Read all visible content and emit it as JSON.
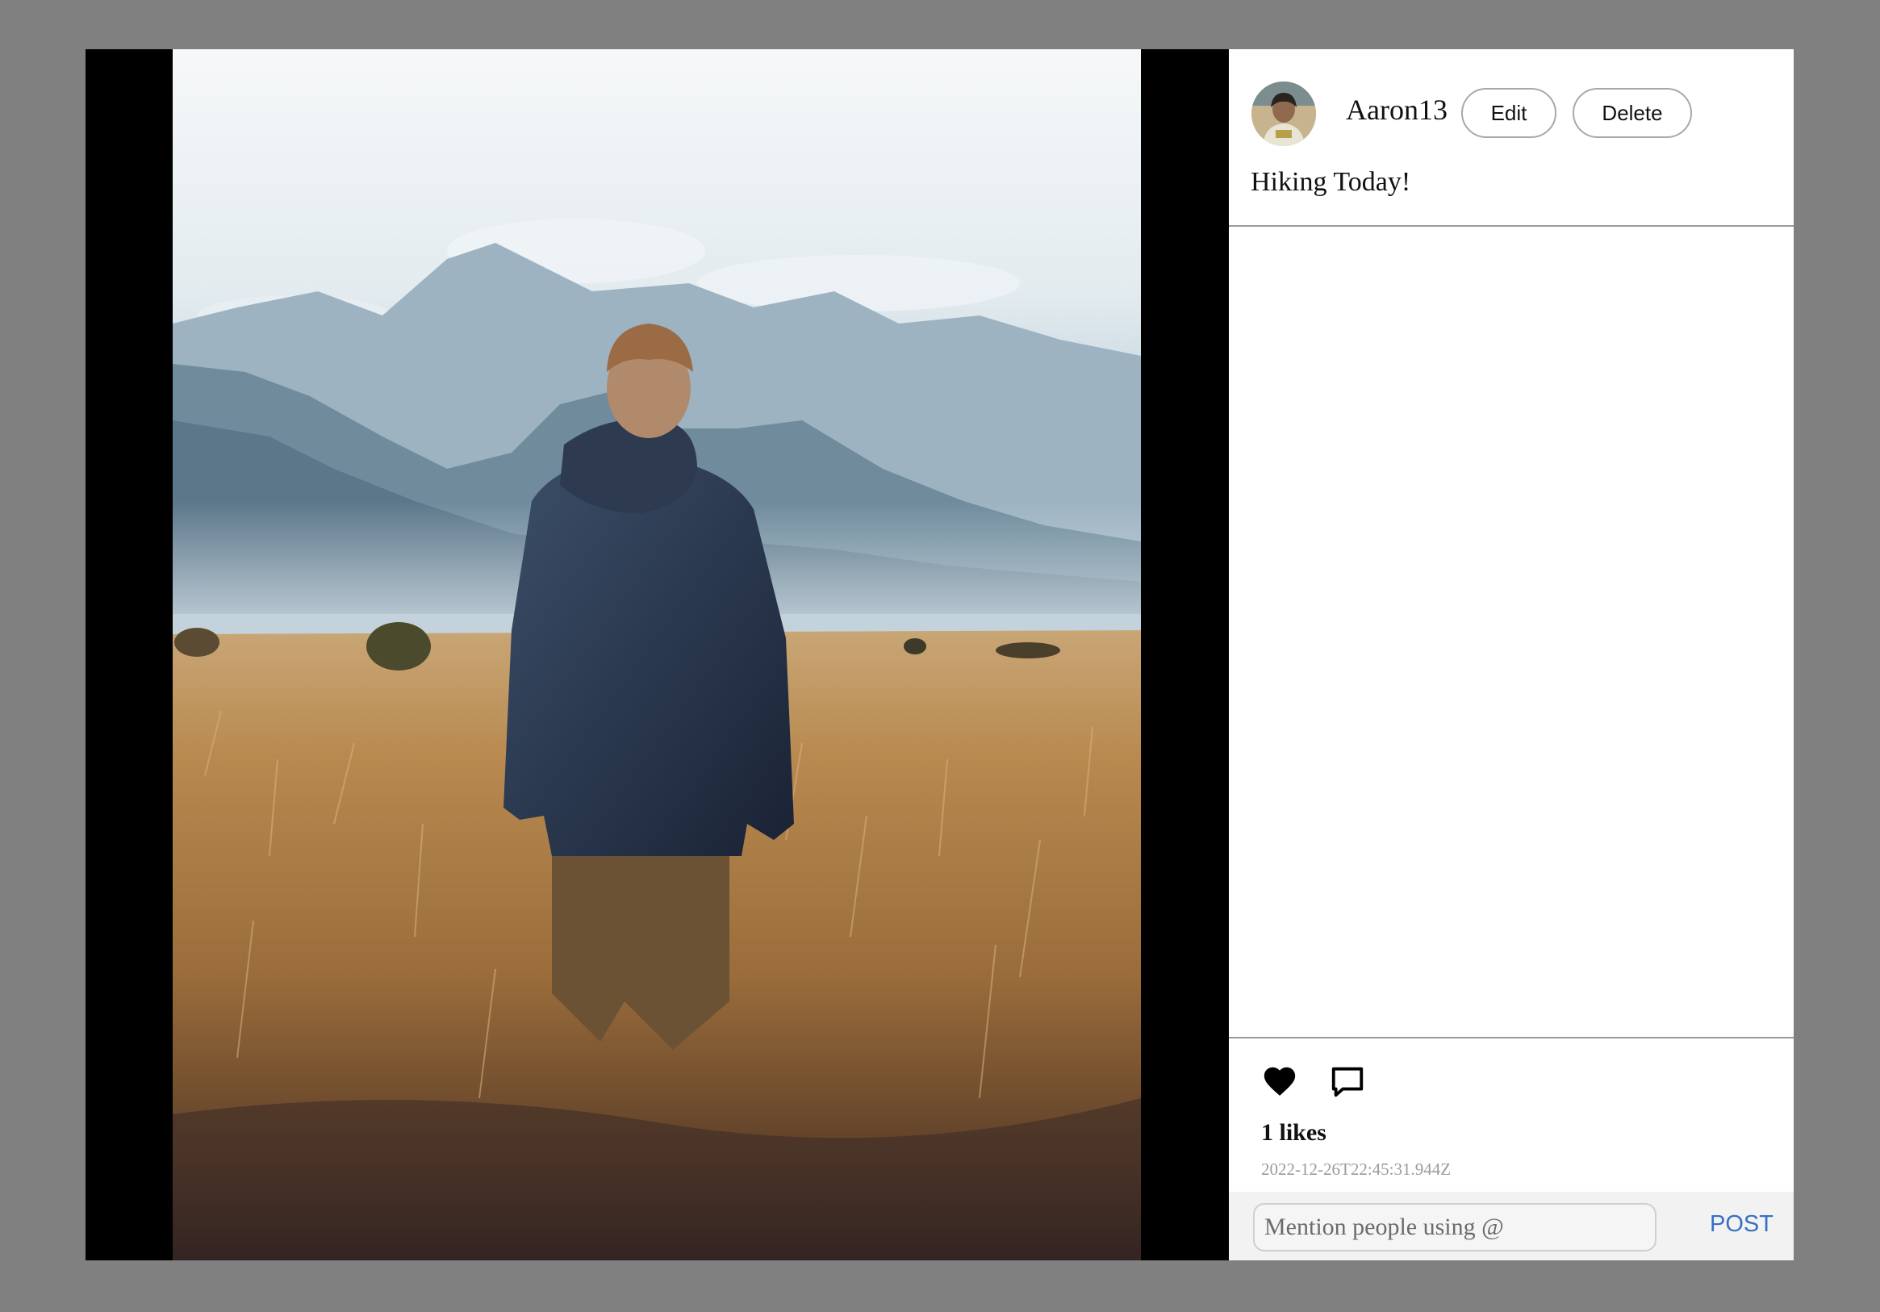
{
  "post": {
    "username": "Aaron13",
    "caption": "Hiking Today!",
    "likes_text": "1 likes",
    "timestamp": "2022-12-26T22:45:31.944Z"
  },
  "header": {
    "edit_label": "Edit",
    "delete_label": "Delete"
  },
  "actions": {
    "like_icon": "heart-icon",
    "comment_icon": "comment-icon"
  },
  "comment_box": {
    "placeholder": "Mention people using @",
    "value": "",
    "post_label": "POST"
  },
  "colors": {
    "backdrop": "#808080",
    "post_button": "#3a6fc4",
    "timestamp": "#9b9b9b"
  }
}
